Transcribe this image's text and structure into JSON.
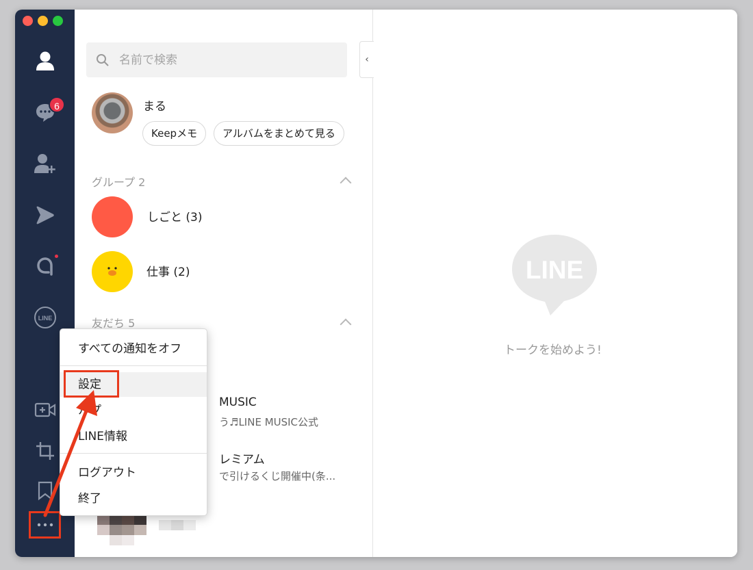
{
  "search": {
    "placeholder": "名前で検索"
  },
  "profile": {
    "name": "まる",
    "buttons": [
      "Keepメモ",
      "アルバムをまとめて見る"
    ]
  },
  "groups": {
    "header": "グループ 2",
    "items": [
      {
        "name": "しごと (3)"
      },
      {
        "name": "仕事 (2)"
      }
    ]
  },
  "friends": {
    "header": "友だち 5",
    "items": [
      {
        "name": "MUSIC",
        "sub": "う♬LINE MUSIC公式"
      },
      {
        "name": "レミアム",
        "sub": "で引けるくじ開催中(条..."
      }
    ]
  },
  "rail": {
    "chat_badge": "6",
    "line_icon_text": "LINE"
  },
  "menu": {
    "items": [
      "すべての通知をオフ",
      "設定",
      "ルプ",
      "LINE情報",
      "ログアウト",
      "終了"
    ]
  },
  "chat": {
    "logo_text": "LINE",
    "empty_message": "トークを始めよう!"
  },
  "colors": {
    "rail": "#1f2c46",
    "badge": "#e8334a",
    "highlight": "#e8391c",
    "group1": "#ff5a45",
    "group2": "#ffd600"
  }
}
